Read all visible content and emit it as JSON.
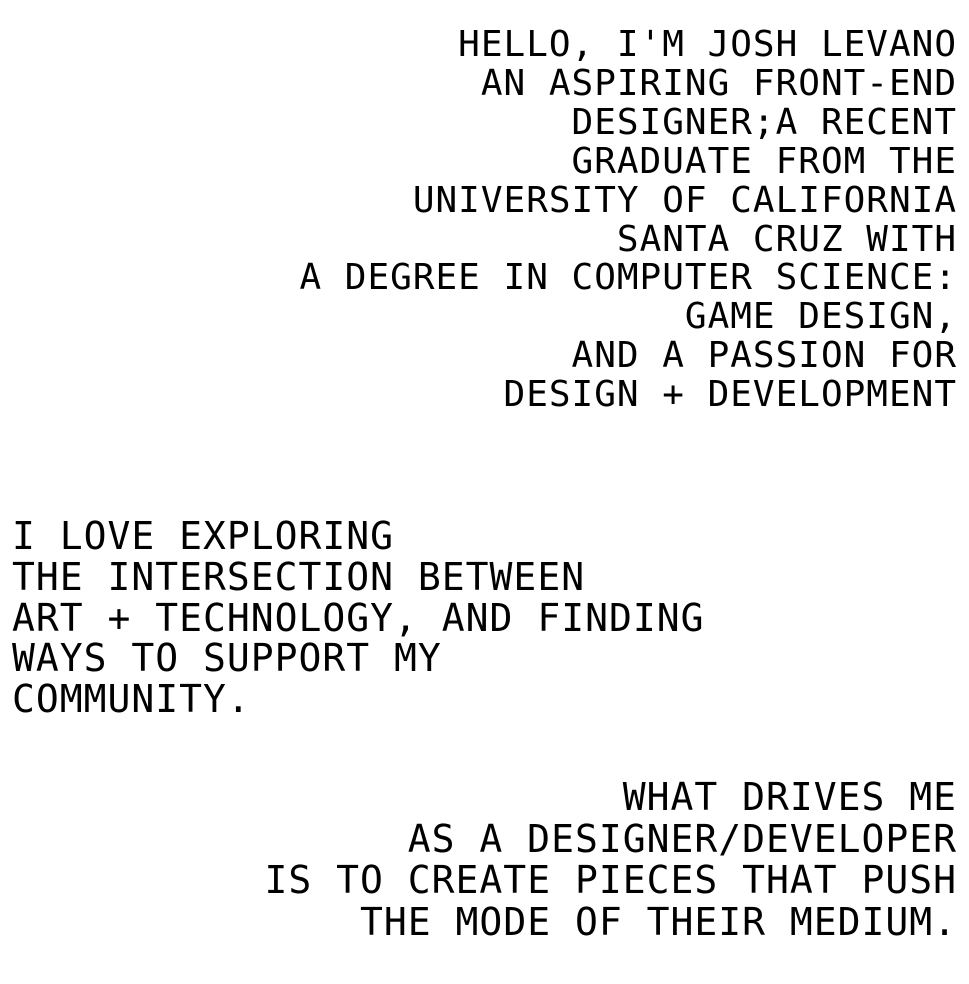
{
  "intro": {
    "lines": [
      "HELLO, I'M JOSH LEVANO",
      "AN ASPIRING FRONT-END",
      "DESIGNER;A RECENT",
      "GRADUATE FROM THE",
      "UNIVERSITY OF CALIFORNIA",
      "SANTA CRUZ WITH",
      "A DEGREE IN COMPUTER SCIENCE:",
      "GAME DESIGN,",
      "AND A PASSION FOR",
      "DESIGN + DEVELOPMENT"
    ]
  },
  "interests": {
    "lines": [
      "I LOVE EXPLORING",
      "THE INTERSECTION BETWEEN",
      "ART + TECHNOLOGY, AND FINDING",
      "WAYS TO SUPPORT MY",
      "COMMUNITY."
    ]
  },
  "motivation": {
    "lines": [
      "WHAT DRIVES ME",
      "AS A DESIGNER/DEVELOPER",
      "IS TO CREATE PIECES THAT PUSH",
      "THE MODE OF THEIR MEDIUM."
    ]
  },
  "accent_color": "#000000",
  "background_color": "#ffffff"
}
